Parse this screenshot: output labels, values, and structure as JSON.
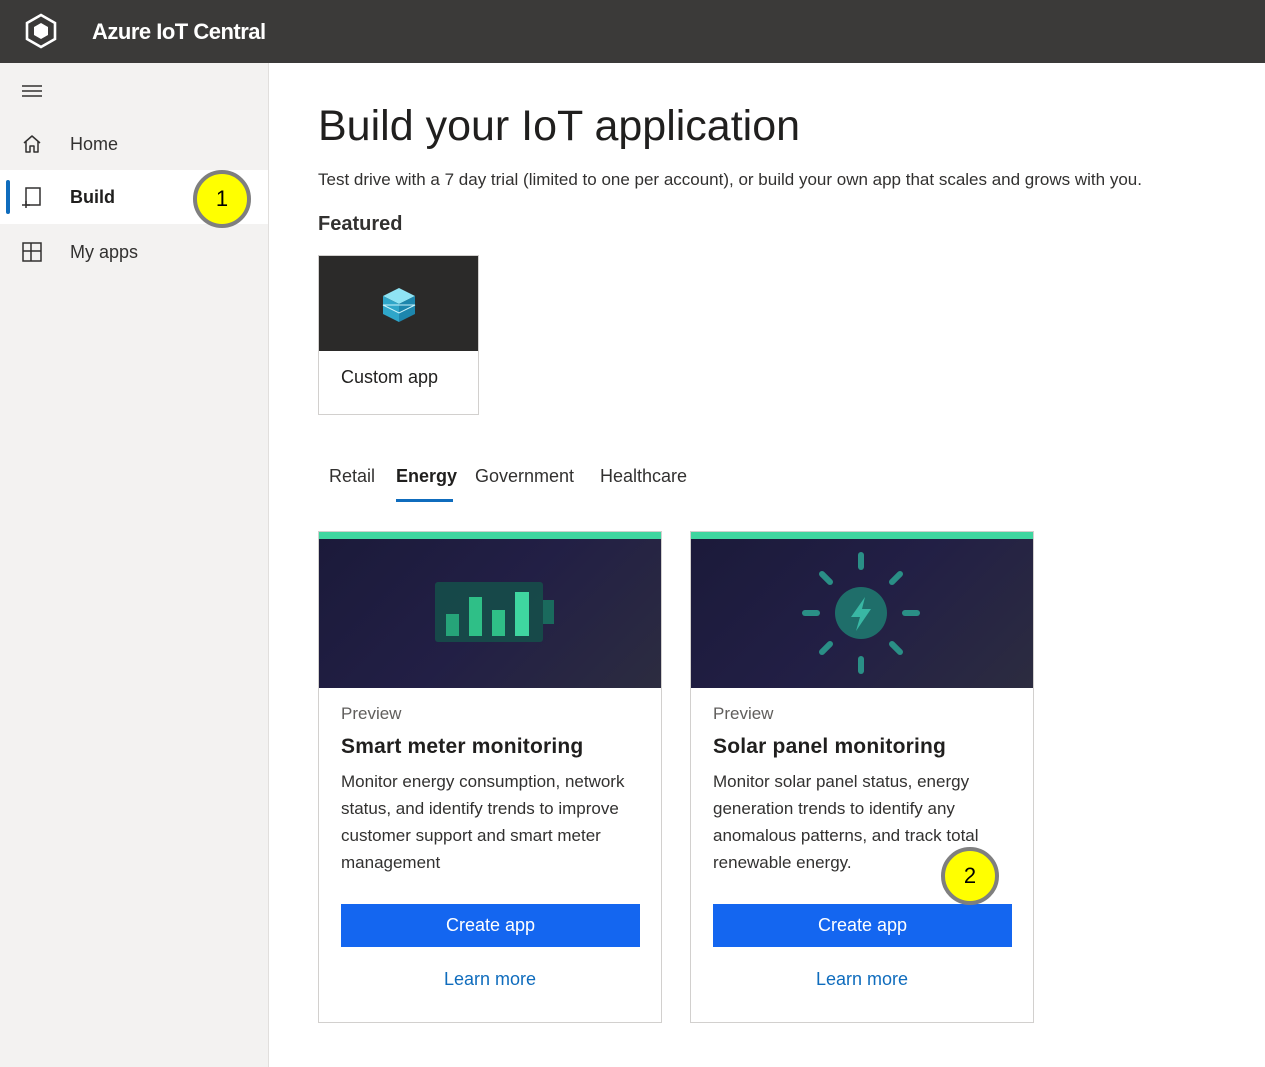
{
  "header": {
    "app_title": "Azure IoT Central",
    "logo_icon": "iot-central-hexagon-icon"
  },
  "sidebar": {
    "menu_icon": "hamburger-icon",
    "items": [
      {
        "label": "Home",
        "icon": "home-icon",
        "active": false
      },
      {
        "label": "Build",
        "icon": "build-icon",
        "active": true
      },
      {
        "label": "My apps",
        "icon": "my-apps-icon",
        "active": false
      }
    ],
    "accent_color": "#0f6cbd"
  },
  "main": {
    "title": "Build your IoT application",
    "subtitle": "Test drive with a 7 day trial (limited to one per account), or build your own app that scales and grows with you.",
    "featured": {
      "heading": "Featured",
      "card": {
        "label": "Custom app",
        "icon": "cube-stack-icon"
      }
    },
    "tabs": [
      {
        "label": "Retail",
        "active": false
      },
      {
        "label": "Energy",
        "active": true
      },
      {
        "label": "Government",
        "active": false
      },
      {
        "label": "Healthcare",
        "active": false
      }
    ],
    "templates": [
      {
        "badge": "Preview",
        "title": "Smart meter monitoring",
        "description": "Monitor energy consumption, network status, and identify trends to improve customer support and smart meter management",
        "create_label": "Create app",
        "learn_label": "Learn more",
        "hero_icon": "battery-chart-icon"
      },
      {
        "badge": "Preview",
        "title": "Solar panel monitoring",
        "description": "Monitor solar panel status, energy generation trends to identify any anomalous patterns, and track total renewable energy.",
        "create_label": "Create app",
        "learn_label": "Learn more",
        "hero_icon": "sun-bolt-icon"
      }
    ]
  },
  "callouts": [
    "1",
    "2"
  ],
  "colors": {
    "topbar": "#3b3a39",
    "primary_button": "#1466f0",
    "card_accent": "#3fd6a0",
    "callout_fill": "#ffff00"
  }
}
